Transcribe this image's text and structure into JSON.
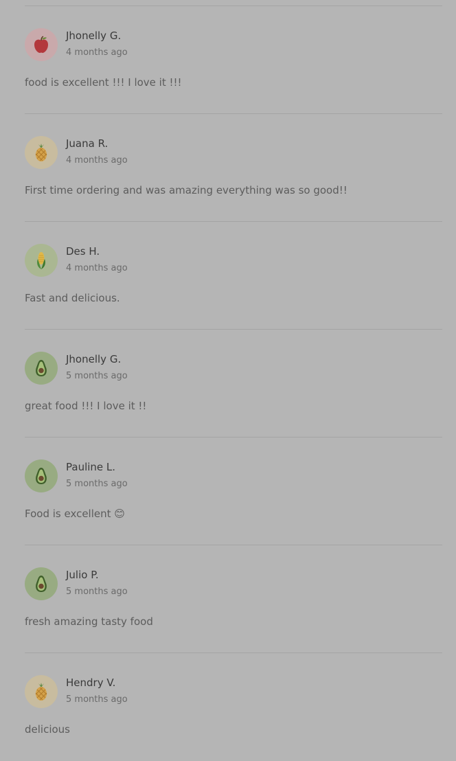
{
  "reviews": [
    {
      "name": "Jhonelly G.",
      "time": "4 months ago",
      "text": "food is excellent !!! I love it !!!",
      "avatar": "apple-icon"
    },
    {
      "name": "Juana R.",
      "time": "4 months ago",
      "text": "First time ordering and was amazing everything was so good!!",
      "avatar": "pineapple-icon"
    },
    {
      "name": "Des H.",
      "time": "4 months ago",
      "text": "Fast and delicious.",
      "avatar": "corn-icon"
    },
    {
      "name": "Jhonelly G.",
      "time": "5 months ago",
      "text": "great food !!! I love it !!",
      "avatar": "avocado-icon"
    },
    {
      "name": "Pauline L.",
      "time": "5 months ago",
      "text": "Food is excellent 😊",
      "avatar": "avocado-icon"
    },
    {
      "name": "Julio P.",
      "time": "5 months ago",
      "text": "fresh amazing tasty food",
      "avatar": "avocado-icon"
    },
    {
      "name": "Hendry V.",
      "time": "5 months ago",
      "text": "delicious",
      "avatar": "pineapple-icon"
    }
  ],
  "colors": {
    "background": "#b5b5b5",
    "divider": "#a4a4a4",
    "name_text": "#3a3a3a",
    "time_text": "#6a6a6a",
    "body_text": "#5c5c5c"
  }
}
